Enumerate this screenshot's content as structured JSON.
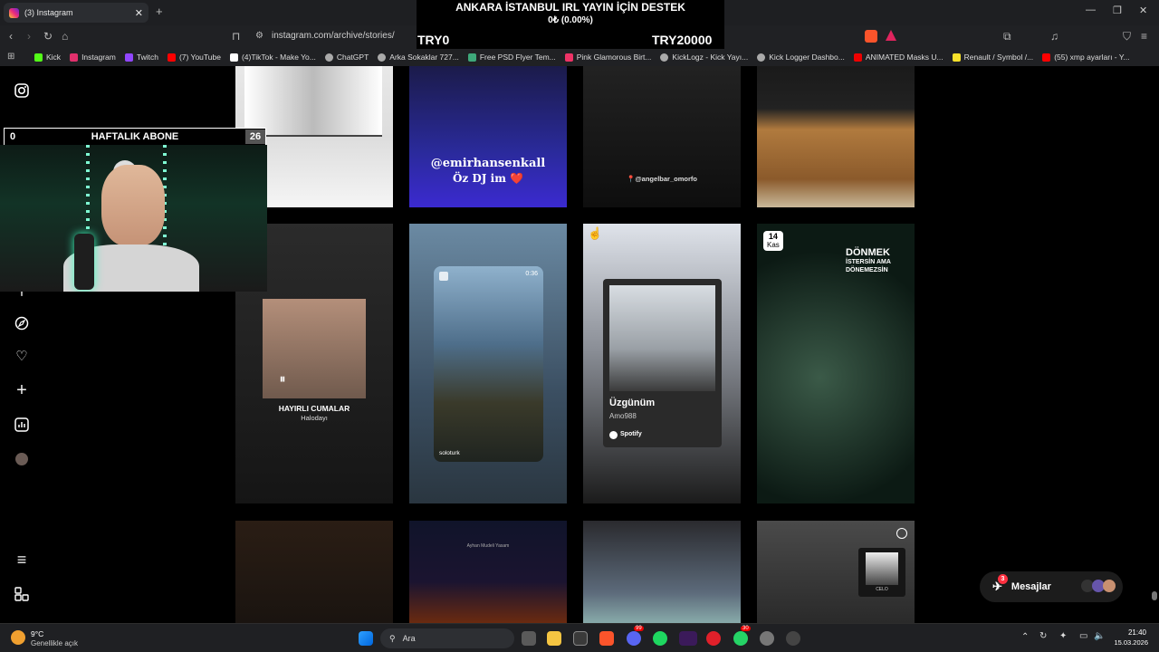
{
  "browser": {
    "tab_title": "(3) Instagram",
    "url": "instagram.com/archive/stories/",
    "bookmarks": [
      "Kick",
      "Instagram",
      "Twitch",
      "(7) YouTube",
      "(4)TikTok - Make Yo...",
      "ChatGPT",
      "Arka Sokaklar 727...",
      "Free PSD Flyer Tem...",
      "Pink Glamorous Birt...",
      "KickLogz - Kick Yayı...",
      "Kick Logger Dashbo...",
      "ANIMATED Masks U...",
      "Renault / Symbol /...",
      "(55) xmp ayarları - Y..."
    ],
    "bookmark_colors": [
      "#53fc18",
      "#e1306c",
      "#9146ff",
      "#ff0000",
      "#ffffff",
      "#cccccc",
      "#cccccc",
      "#3ea87a",
      "#e36",
      "#cccccc",
      "#cccccc",
      "#e00",
      "#f7e12b",
      "#ff0000"
    ]
  },
  "overlay": {
    "title": "ANKARA İSTANBUL IRL YAYIN İÇİN DESTEK",
    "progress": "0₺ (0.00%)",
    "min": "TRY0",
    "max": "TRY20000"
  },
  "stream": {
    "abone_label": "HAFTALIK ABONE",
    "abone_left": "0",
    "abone_right": "26"
  },
  "sidebar": {
    "icons": [
      "instagram-icon",
      "search-icon",
      "explore-icon",
      "heart-icon",
      "create-icon",
      "insights-icon",
      "profile-avatar",
      "menu-icon",
      "more-icon"
    ]
  },
  "stories": {
    "t2_text1": "@emirhansenkall",
    "t2_text2": "Öz DJ im ❤️",
    "t3_text": "📍@angelbar_omorfo",
    "t5_title": "HAYIRLI CUMALAR",
    "t5_sub": "Halodayı",
    "t6_time": "0:36",
    "t6_caption": "soloturk",
    "t7_song": "Üzgünüm",
    "t7_artist": "Amo988",
    "t7_brand": "Spotify",
    "t8_day": "14",
    "t8_month": "Kas",
    "t8_text1": "DÖNMEK",
    "t8_text2": "İSTERSİN AMA",
    "t8_text3": "DÖNEMEZSİN",
    "t10_text": "Ayhan Mudeli Yasam",
    "t12_label": "CELO"
  },
  "messages": {
    "label": "Mesajlar",
    "badge": "3"
  },
  "taskbar": {
    "weather_temp": "9°C",
    "weather_desc": "Genellikle açık",
    "search": "Ara",
    "time": "21:40",
    "date": "15.03.2026",
    "discord_badge": "99",
    "whatsapp_badge": "30"
  }
}
